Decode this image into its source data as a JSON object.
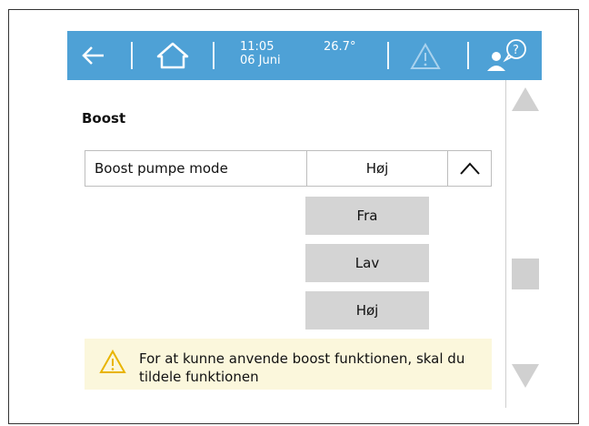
{
  "header": {
    "back_icon": "arrow-left-icon",
    "home_icon": "home-icon",
    "time": "11:05",
    "date": "06 Juni",
    "temperature": "26.7°",
    "alert_icon": "warning-triangle-icon",
    "user_icon": "user-help-icon"
  },
  "section": {
    "title": "Boost"
  },
  "setting": {
    "label": "Boost pumpe mode",
    "value": "Høj",
    "toggle_icon": "chevron-up-icon"
  },
  "options": [
    "Fra",
    "Lav",
    "Høj"
  ],
  "warning": {
    "icon": "warning-triangle-icon",
    "text": "For at kunne anvende boost funktionen, skal du tildele funktionen"
  },
  "colors": {
    "header_bg": "#4ea1d6",
    "option_bg": "#d4d4d4",
    "warning_bg": "#fbf7dc",
    "scroll_gray": "#d0d0d0"
  }
}
